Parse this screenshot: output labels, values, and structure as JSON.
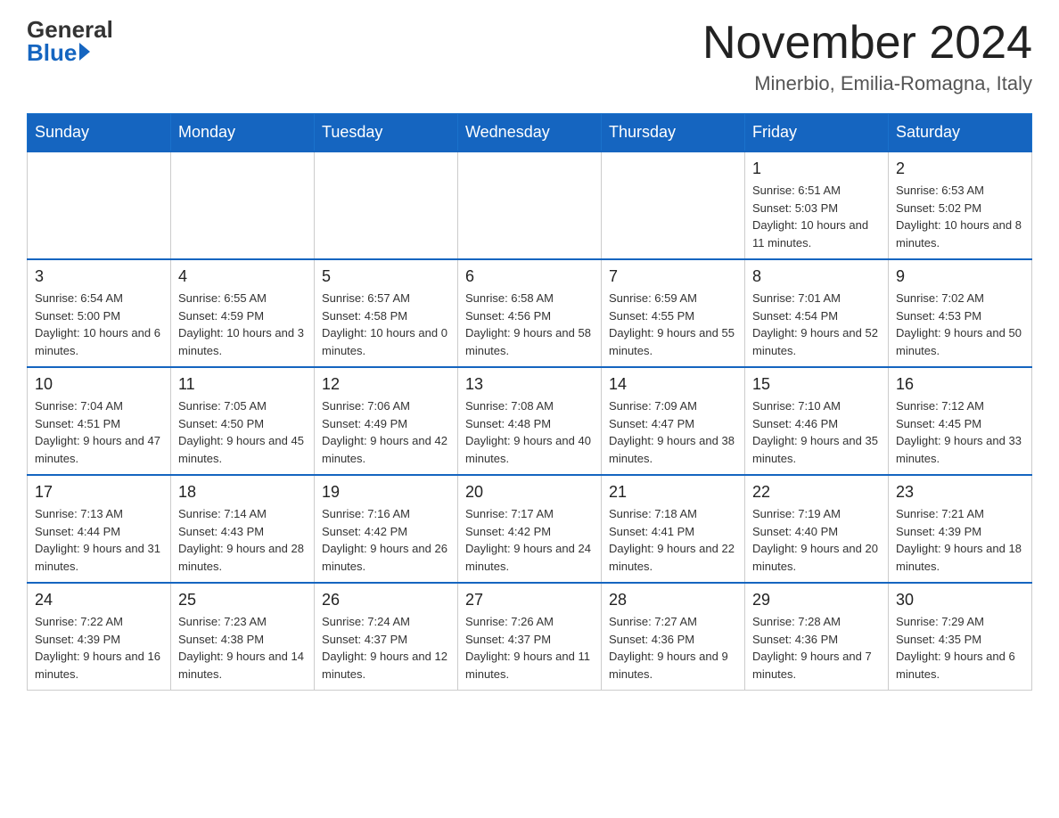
{
  "header": {
    "logo_general": "General",
    "logo_blue": "Blue",
    "title": "November 2024",
    "location": "Minerbio, Emilia-Romagna, Italy"
  },
  "days_of_week": [
    "Sunday",
    "Monday",
    "Tuesday",
    "Wednesday",
    "Thursday",
    "Friday",
    "Saturday"
  ],
  "weeks": [
    [
      {
        "num": "",
        "info": ""
      },
      {
        "num": "",
        "info": ""
      },
      {
        "num": "",
        "info": ""
      },
      {
        "num": "",
        "info": ""
      },
      {
        "num": "",
        "info": ""
      },
      {
        "num": "1",
        "info": "Sunrise: 6:51 AM\nSunset: 5:03 PM\nDaylight: 10 hours and 11 minutes."
      },
      {
        "num": "2",
        "info": "Sunrise: 6:53 AM\nSunset: 5:02 PM\nDaylight: 10 hours and 8 minutes."
      }
    ],
    [
      {
        "num": "3",
        "info": "Sunrise: 6:54 AM\nSunset: 5:00 PM\nDaylight: 10 hours and 6 minutes."
      },
      {
        "num": "4",
        "info": "Sunrise: 6:55 AM\nSunset: 4:59 PM\nDaylight: 10 hours and 3 minutes."
      },
      {
        "num": "5",
        "info": "Sunrise: 6:57 AM\nSunset: 4:58 PM\nDaylight: 10 hours and 0 minutes."
      },
      {
        "num": "6",
        "info": "Sunrise: 6:58 AM\nSunset: 4:56 PM\nDaylight: 9 hours and 58 minutes."
      },
      {
        "num": "7",
        "info": "Sunrise: 6:59 AM\nSunset: 4:55 PM\nDaylight: 9 hours and 55 minutes."
      },
      {
        "num": "8",
        "info": "Sunrise: 7:01 AM\nSunset: 4:54 PM\nDaylight: 9 hours and 52 minutes."
      },
      {
        "num": "9",
        "info": "Sunrise: 7:02 AM\nSunset: 4:53 PM\nDaylight: 9 hours and 50 minutes."
      }
    ],
    [
      {
        "num": "10",
        "info": "Sunrise: 7:04 AM\nSunset: 4:51 PM\nDaylight: 9 hours and 47 minutes."
      },
      {
        "num": "11",
        "info": "Sunrise: 7:05 AM\nSunset: 4:50 PM\nDaylight: 9 hours and 45 minutes."
      },
      {
        "num": "12",
        "info": "Sunrise: 7:06 AM\nSunset: 4:49 PM\nDaylight: 9 hours and 42 minutes."
      },
      {
        "num": "13",
        "info": "Sunrise: 7:08 AM\nSunset: 4:48 PM\nDaylight: 9 hours and 40 minutes."
      },
      {
        "num": "14",
        "info": "Sunrise: 7:09 AM\nSunset: 4:47 PM\nDaylight: 9 hours and 38 minutes."
      },
      {
        "num": "15",
        "info": "Sunrise: 7:10 AM\nSunset: 4:46 PM\nDaylight: 9 hours and 35 minutes."
      },
      {
        "num": "16",
        "info": "Sunrise: 7:12 AM\nSunset: 4:45 PM\nDaylight: 9 hours and 33 minutes."
      }
    ],
    [
      {
        "num": "17",
        "info": "Sunrise: 7:13 AM\nSunset: 4:44 PM\nDaylight: 9 hours and 31 minutes."
      },
      {
        "num": "18",
        "info": "Sunrise: 7:14 AM\nSunset: 4:43 PM\nDaylight: 9 hours and 28 minutes."
      },
      {
        "num": "19",
        "info": "Sunrise: 7:16 AM\nSunset: 4:42 PM\nDaylight: 9 hours and 26 minutes."
      },
      {
        "num": "20",
        "info": "Sunrise: 7:17 AM\nSunset: 4:42 PM\nDaylight: 9 hours and 24 minutes."
      },
      {
        "num": "21",
        "info": "Sunrise: 7:18 AM\nSunset: 4:41 PM\nDaylight: 9 hours and 22 minutes."
      },
      {
        "num": "22",
        "info": "Sunrise: 7:19 AM\nSunset: 4:40 PM\nDaylight: 9 hours and 20 minutes."
      },
      {
        "num": "23",
        "info": "Sunrise: 7:21 AM\nSunset: 4:39 PM\nDaylight: 9 hours and 18 minutes."
      }
    ],
    [
      {
        "num": "24",
        "info": "Sunrise: 7:22 AM\nSunset: 4:39 PM\nDaylight: 9 hours and 16 minutes."
      },
      {
        "num": "25",
        "info": "Sunrise: 7:23 AM\nSunset: 4:38 PM\nDaylight: 9 hours and 14 minutes."
      },
      {
        "num": "26",
        "info": "Sunrise: 7:24 AM\nSunset: 4:37 PM\nDaylight: 9 hours and 12 minutes."
      },
      {
        "num": "27",
        "info": "Sunrise: 7:26 AM\nSunset: 4:37 PM\nDaylight: 9 hours and 11 minutes."
      },
      {
        "num": "28",
        "info": "Sunrise: 7:27 AM\nSunset: 4:36 PM\nDaylight: 9 hours and 9 minutes."
      },
      {
        "num": "29",
        "info": "Sunrise: 7:28 AM\nSunset: 4:36 PM\nDaylight: 9 hours and 7 minutes."
      },
      {
        "num": "30",
        "info": "Sunrise: 7:29 AM\nSunset: 4:35 PM\nDaylight: 9 hours and 6 minutes."
      }
    ]
  ]
}
